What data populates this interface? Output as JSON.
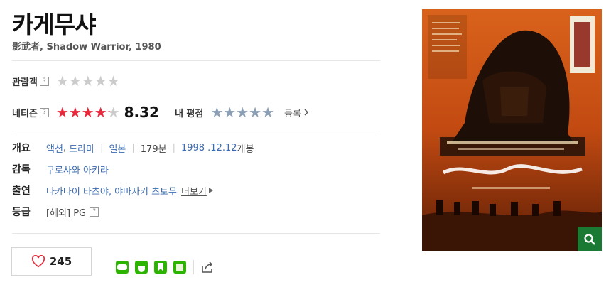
{
  "movie": {
    "title": "카게무샤",
    "subtitle": "影武者, Shadow Warrior, 1980"
  },
  "ratings": {
    "audience_label": "관람객",
    "audience_stars": 0,
    "netizen_label": "네티즌",
    "netizen_stars": 4.2,
    "netizen_score": "8.32",
    "my_rating_label": "내 평점",
    "register_label": "등록"
  },
  "info": {
    "overview_label": "개요",
    "genres": [
      "액션",
      "드라마"
    ],
    "country": "일본",
    "runtime": "179분",
    "release_date": "1998 .12.12",
    "release_suffix": "개봉",
    "director_label": "감독",
    "director": "구로사와 아키라",
    "cast_label": "출연",
    "cast": "나카다이 타츠야, 야마자키 츠토무",
    "more_label": "더보기",
    "grade_label": "등급",
    "grade": "[해외] PG"
  },
  "like": {
    "count": "245"
  },
  "help_icon": "?",
  "colors": {
    "accent_red": "#e8283a",
    "link_blue": "#3a6ab0",
    "zoom_green": "#1a7a34"
  }
}
